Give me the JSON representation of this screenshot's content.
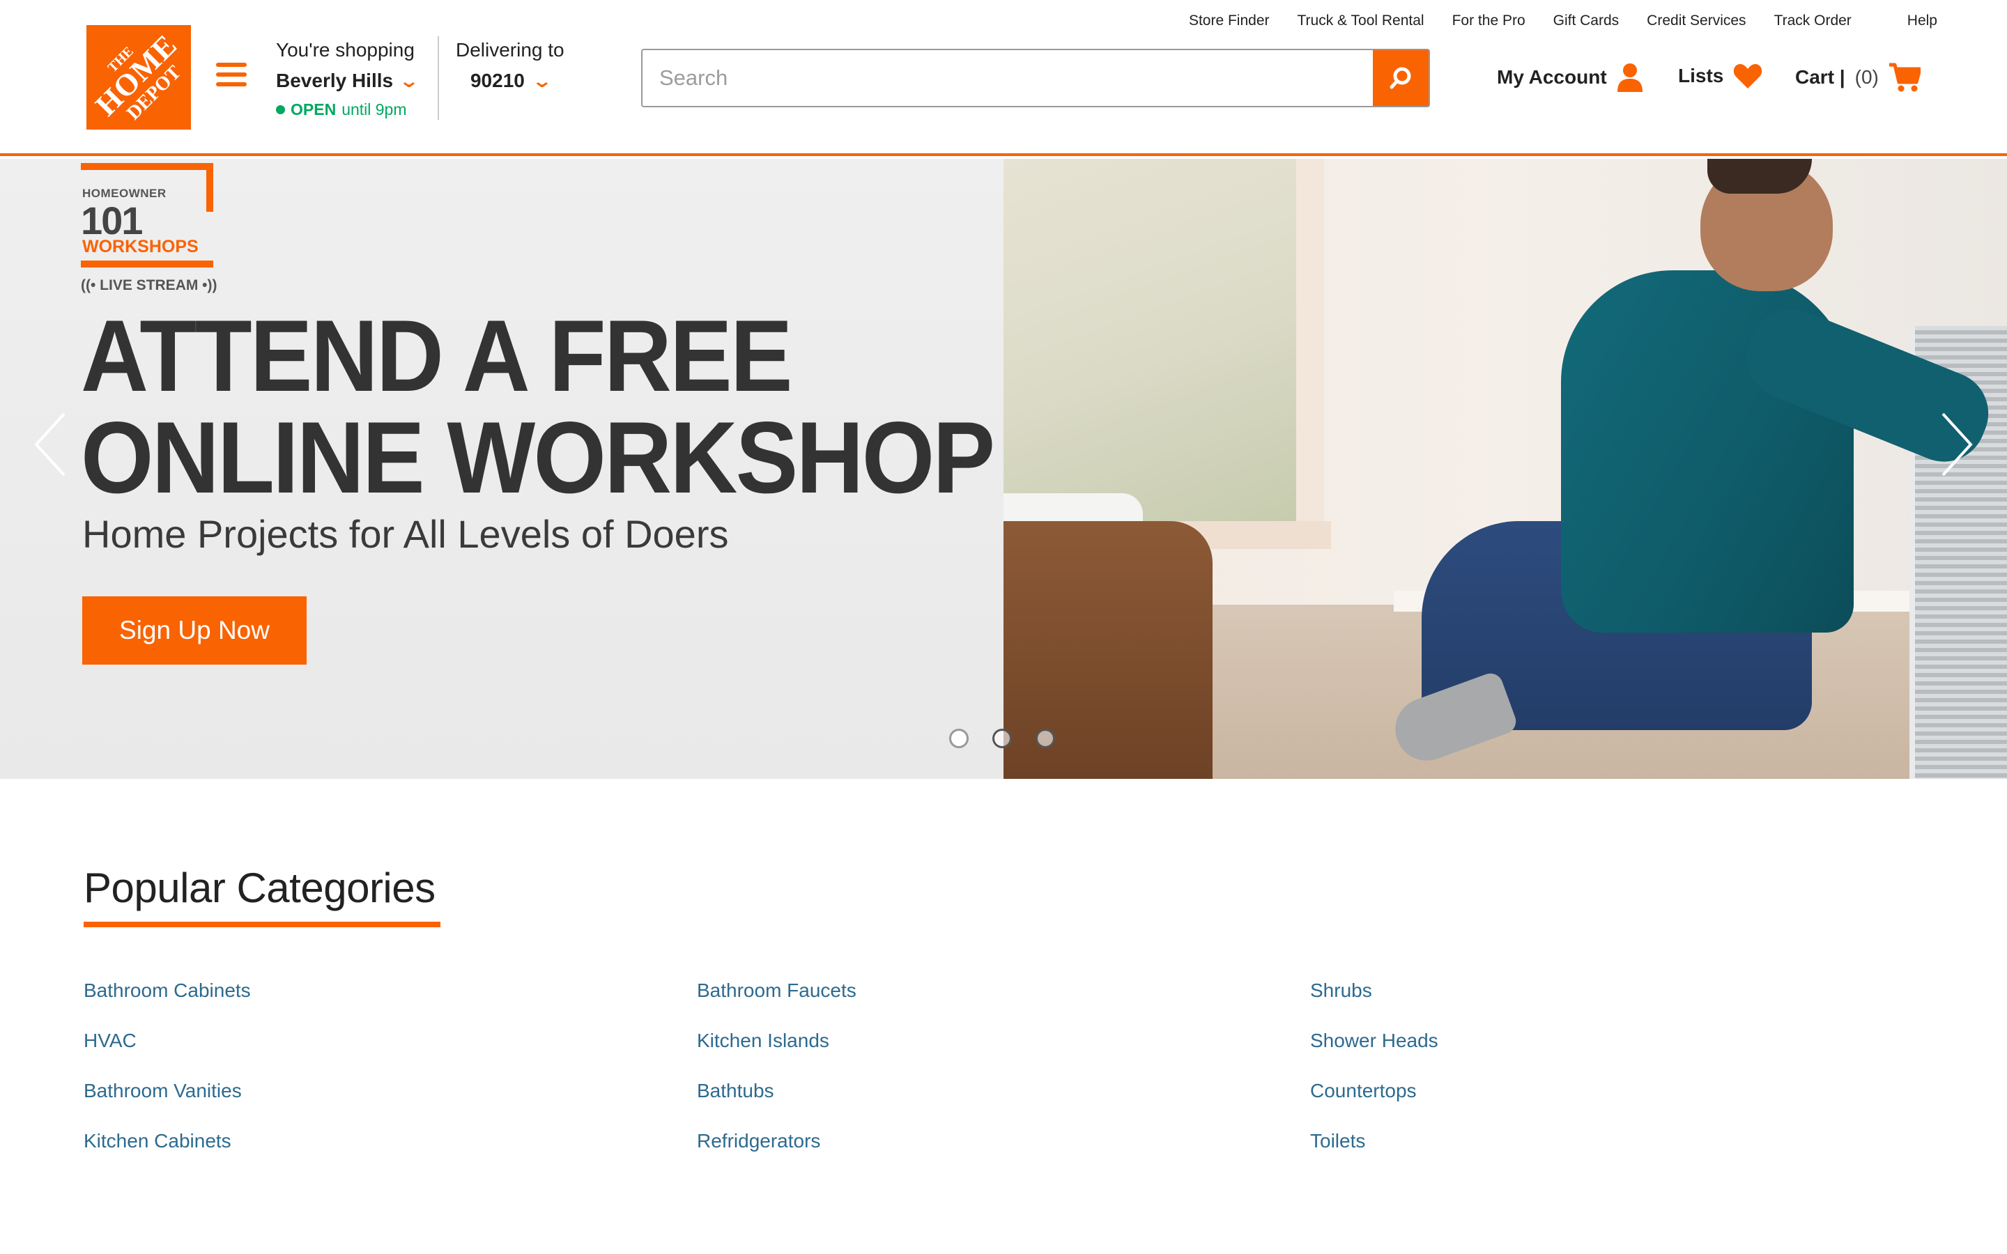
{
  "utility_nav": [
    "Store Finder",
    "Truck & Tool Rental",
    "For the Pro",
    "Gift Cards",
    "Credit Services",
    "Track Order",
    "Help"
  ],
  "logo": {
    "line1": "THE",
    "line2": "HOME",
    "line3": "DEPOT"
  },
  "store": {
    "label": "You're shopping",
    "name": "Beverly Hills",
    "status": "OPEN",
    "hours": "until 9pm"
  },
  "delivery": {
    "label": "Delivering to",
    "zip": "90210"
  },
  "search": {
    "placeholder": "Search",
    "value": ""
  },
  "account": {
    "my_account": "My Account",
    "lists": "Lists",
    "cart": "Cart |",
    "cart_count": "(0)"
  },
  "hero": {
    "badge_top": "HOMEOWNER",
    "badge_num": "101",
    "badge_bottom": "WORKSHOPS",
    "live_stream": "((• LIVE STREAM •))",
    "headline_1": "ATTEND A FREE",
    "headline_2": "ONLINE WORKSHOP",
    "subhead": "Home Projects for All Levels of Doers",
    "cta": "Sign Up Now",
    "slides": 3,
    "active_slide": 1
  },
  "popular": {
    "title": "Popular Categories",
    "columns": [
      [
        "Bathroom Cabinets",
        "HVAC",
        "Bathroom Vanities",
        "Kitchen Cabinets"
      ],
      [
        "Bathroom Faucets",
        "Kitchen Islands",
        "Bathtubs",
        "Refridgerators"
      ],
      [
        "Shrubs",
        "Shower Heads",
        "Countertops",
        "Toilets"
      ]
    ]
  },
  "colors": {
    "brand_orange": "#f96302",
    "link_blue": "#2d6a8f",
    "open_green": "#00a862"
  }
}
